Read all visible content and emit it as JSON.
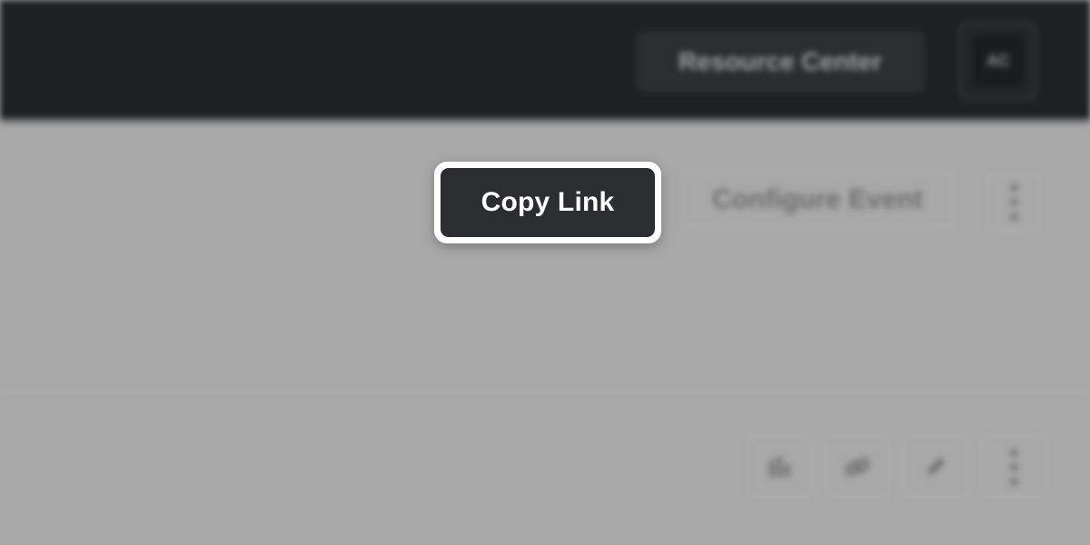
{
  "header": {
    "resource_center_label": "Resource Center",
    "avatar_initials": "AC"
  },
  "toolbar": {
    "copy_link_label": "Copy Link",
    "configure_event_label": "Configure Event"
  },
  "row": {
    "actions": [
      {
        "icon": "bar-chart-icon"
      },
      {
        "icon": "link-icon"
      },
      {
        "icon": "edit-icon"
      },
      {
        "icon": "more-vertical-icon"
      }
    ]
  },
  "colors": {
    "topbar": "#1f2022",
    "page_background": "#a7a8a7",
    "copy_link_button": "#2b2d30"
  }
}
